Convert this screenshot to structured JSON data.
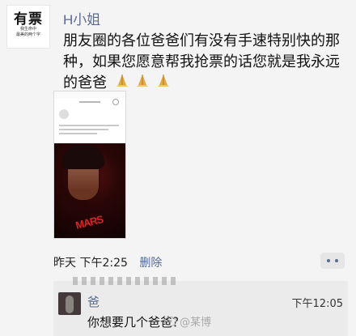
{
  "profile": {
    "avatar_text_main": "有票",
    "avatar_text_small_1": "我生命中",
    "avatar_text_small_2": "最美的两个字"
  },
  "post": {
    "author": "H小姐",
    "text": "朋友圈的各位爸爸们有没有手速特别快的那种，如果您愿意帮我抢票的话您就是我永远的爸爸",
    "emoji": [
      "praying-hands",
      "praying-hands",
      "praying-hands"
    ],
    "time": "昨天 下午2:25",
    "delete_label": "删除"
  },
  "post_image": {
    "poster_text": "MARS"
  },
  "comment": {
    "name": "爸",
    "time": "下午12:05",
    "text": "你想要几个爸爸？"
  },
  "watermark": {
    "text": "@某博"
  },
  "colors": {
    "author": "#5b6b93",
    "link": "#576b95",
    "background": "#f4f4f4"
  }
}
